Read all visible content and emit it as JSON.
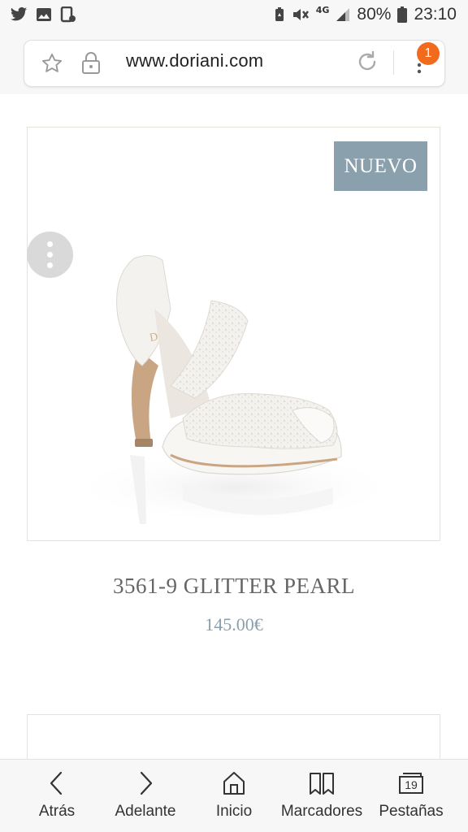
{
  "status_bar": {
    "left_icons": [
      "twitter-icon",
      "gallery-icon",
      "screenshot-icon"
    ],
    "right_icons": [
      "battery-saver-icon",
      "mute-icon",
      "signal-icon",
      "battery-icon"
    ],
    "network": "4G",
    "battery": "80%",
    "time": "23:10"
  },
  "browser": {
    "url": "www.doriani.com",
    "tab_badge": "1"
  },
  "product": {
    "badge": "NUEVO",
    "name": "3561-9 GLITTER PEARL",
    "price": "145.00€"
  },
  "bottom_nav": {
    "items": [
      {
        "label": "Atrás",
        "icon": "chevron-left-icon"
      },
      {
        "label": "Adelante",
        "icon": "chevron-right-icon"
      },
      {
        "label": "Inicio",
        "icon": "home-icon"
      },
      {
        "label": "Marcadores",
        "icon": "bookmarks-icon"
      },
      {
        "label": "Pestañas",
        "icon": "tabs-icon",
        "count": "19"
      }
    ]
  },
  "colors": {
    "accent_badge": "#8aa0ac",
    "notification": "#f26b1d",
    "card_border": "#e6e2d4"
  }
}
